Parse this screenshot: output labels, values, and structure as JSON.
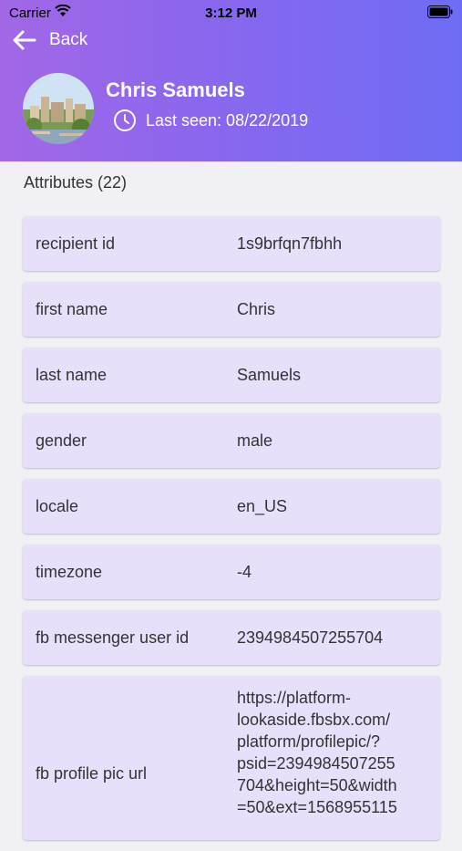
{
  "status_bar": {
    "carrier": "Carrier",
    "time": "3:12 PM"
  },
  "nav": {
    "back_label": "Back"
  },
  "profile": {
    "name": "Chris Samuels",
    "last_seen": "Last seen: 08/22/2019"
  },
  "attributes": {
    "title": "Attributes (22)",
    "items": [
      {
        "key": "recipient id",
        "value": "1s9brfqn7fbhh"
      },
      {
        "key": "first name",
        "value": "Chris"
      },
      {
        "key": "last name",
        "value": "Samuels"
      },
      {
        "key": "gender",
        "value": "male"
      },
      {
        "key": "locale",
        "value": "en_US"
      },
      {
        "key": "timezone",
        "value": "-4"
      },
      {
        "key": "fb messenger user id",
        "value": "2394984507255704"
      },
      {
        "key": "fb profile pic url",
        "value_lines": [
          "https://platform-",
          "lookaside.fbsbx.com/",
          "platform/profilepic/?",
          "psid=2394984507255",
          "704&height=50&width",
          "=50&ext=1568955115"
        ]
      }
    ]
  },
  "colors": {
    "header_start": "#a267e6",
    "header_end": "#6f6cf4",
    "card_bg": "#e8e0fb",
    "page_bg": "#f0f0f5"
  },
  "icons": [
    "wifi-icon",
    "battery-icon",
    "back-arrow-icon",
    "clock-icon"
  ]
}
